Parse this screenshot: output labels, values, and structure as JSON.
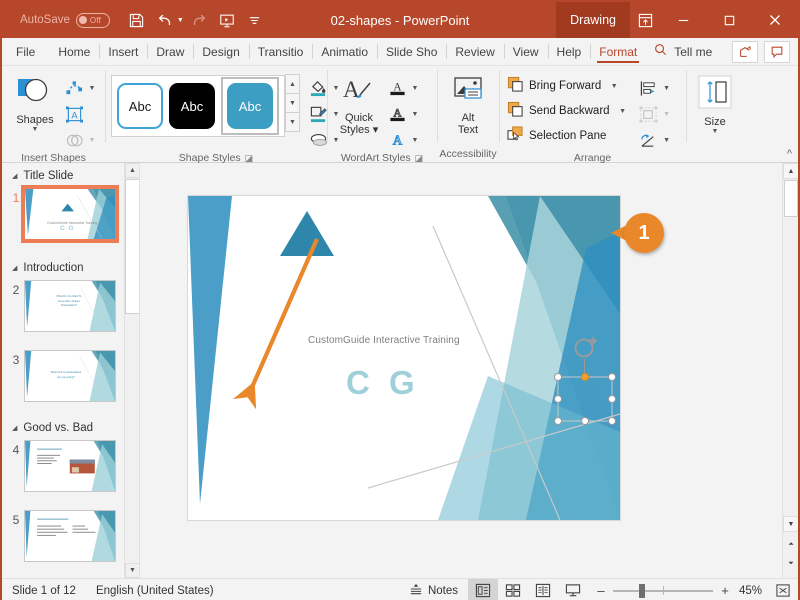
{
  "titlebar": {
    "autosave_label": "AutoSave",
    "autosave_state": "Off",
    "document_title": "02-shapes  -  PowerPoint",
    "ribbon_display_label": "Drawing",
    "qat": [
      {
        "name": "save-icon",
        "tip": "Save"
      },
      {
        "name": "undo-icon",
        "tip": "Undo"
      },
      {
        "name": "redo-icon",
        "tip": "Redo"
      },
      {
        "name": "start-presentation-icon",
        "tip": "Start From Beginning"
      },
      {
        "name": "customize-qat-icon",
        "tip": "Customize Quick Access Toolbar"
      }
    ],
    "window_controls": [
      "minimize",
      "restore",
      "close"
    ],
    "accent_color": "#b7472a"
  },
  "tabs": [
    {
      "label": "File",
      "active": false
    },
    {
      "label": "Home",
      "active": false
    },
    {
      "label": "Insert",
      "active": false
    },
    {
      "label": "Draw",
      "active": false
    },
    {
      "label": "Design",
      "active": false
    },
    {
      "label": "Transitio",
      "active": false
    },
    {
      "label": "Animatio",
      "active": false
    },
    {
      "label": "Slide Sho",
      "active": false
    },
    {
      "label": "Review",
      "active": false
    },
    {
      "label": "View",
      "active": false
    },
    {
      "label": "Help",
      "active": false
    },
    {
      "label": "Format",
      "active": true
    }
  ],
  "tellme": {
    "label": "Tell me",
    "icon": "search-icon"
  },
  "tab_right_buttons": [
    {
      "name": "share-button",
      "icon": "share-icon"
    },
    {
      "name": "comments-button",
      "icon": "comment-icon"
    }
  ],
  "ribbon": {
    "collapse_label": "^",
    "groups": [
      {
        "name": "insert-shapes",
        "label": "Insert Shapes",
        "big_button": {
          "label": "Shapes",
          "icon": "shapes-icon",
          "has_dropdown": true
        },
        "mini_items": [
          {
            "name": "edit-shape-icon",
            "has_dropdown": true,
            "disabled": false
          },
          {
            "name": "draw-textbox-icon",
            "has_dropdown": false,
            "disabled": false
          },
          {
            "name": "merge-shapes-icon",
            "has_dropdown": true,
            "disabled": true
          }
        ]
      },
      {
        "name": "shape-styles",
        "label": "Shape Styles",
        "has_dialog_launcher": true,
        "gallery": [
          {
            "text": "Abc",
            "style": "outline-blue",
            "selected": false
          },
          {
            "text": "Abc",
            "style": "fill-black",
            "selected": false
          },
          {
            "text": "Abc",
            "style": "fill-teal",
            "selected": true
          }
        ],
        "mini_items": [
          {
            "name": "shape-fill-icon",
            "has_dropdown": true
          },
          {
            "name": "shape-outline-icon",
            "has_dropdown": true
          },
          {
            "name": "shape-effects-icon",
            "has_dropdown": true
          }
        ]
      },
      {
        "name": "wordart-styles",
        "label": "WordArt Styles",
        "has_dialog_launcher": true,
        "big_button": {
          "label": "Quick\nStyles",
          "icon": "wordart-quick-styles-icon",
          "has_dropdown": true
        },
        "mini_items": [
          {
            "name": "text-fill-icon",
            "has_dropdown": true
          },
          {
            "name": "text-outline-icon",
            "has_dropdown": true
          },
          {
            "name": "text-effects-icon",
            "has_dropdown": true
          }
        ]
      },
      {
        "name": "accessibility",
        "label": "Accessibility",
        "big_button": {
          "label": "Alt\nText",
          "icon": "alt-text-icon",
          "has_dropdown": false
        }
      },
      {
        "name": "arrange",
        "label": "Arrange",
        "menu_items": [
          {
            "label": "Bring Forward",
            "icon": "bring-forward-icon",
            "has_dropdown": true,
            "disabled": false
          },
          {
            "label": "Send Backward",
            "icon": "send-backward-icon",
            "has_dropdown": true,
            "disabled": false
          },
          {
            "label": "Selection Pane",
            "icon": "selection-pane-icon",
            "has_dropdown": false,
            "disabled": false
          }
        ],
        "mini_items": [
          {
            "name": "align-objects-icon",
            "has_dropdown": true,
            "disabled": false
          },
          {
            "name": "group-objects-icon",
            "has_dropdown": true,
            "disabled": true
          },
          {
            "name": "rotate-objects-icon",
            "has_dropdown": true,
            "disabled": false
          }
        ]
      },
      {
        "name": "size",
        "label": "Size",
        "big_button": {
          "label": "Size",
          "icon": "size-icon",
          "has_dropdown": true
        }
      }
    ]
  },
  "thumbnail_pane": {
    "sections": [
      {
        "title": "Title Slide",
        "slides": [
          {
            "number": "1",
            "selected": true,
            "lines": [],
            "subtitle": "CustomGuide Interactive Training",
            "cg": "C G"
          }
        ]
      },
      {
        "title": "Introduction",
        "slides": [
          {
            "number": "2",
            "selected": false,
            "lines": [
              "What Do You Want To",
              "Know After Today's",
              "Presentation?"
            ]
          },
          {
            "number": "3",
            "selected": false,
            "lines": [
              "What kind of presentations",
              "are you giving?"
            ]
          }
        ]
      },
      {
        "title": "Good vs. Bad",
        "slides": [
          {
            "number": "4",
            "selected": false,
            "lines": [
              "What Makes a Bad Presentation?"
            ]
          },
          {
            "number": "5",
            "selected": false,
            "lines": [
              "What Makes a Presentation Good?"
            ]
          }
        ]
      }
    ]
  },
  "slide": {
    "subtitle": "CustomGuide Interactive Training",
    "logo_text": "C G",
    "selected_shape": {
      "name": "triangle",
      "fill": "#2e86ab"
    },
    "callout_badge": "1",
    "annotation_arrow_color": "#e8882b"
  },
  "statusbar": {
    "slide_indicator": "Slide 1 of 12",
    "language": "English (United States)",
    "notes_label": "Notes",
    "views": [
      {
        "name": "normal-view",
        "active": true
      },
      {
        "name": "slide-sorter-view",
        "active": false
      },
      {
        "name": "reading-view",
        "active": false
      },
      {
        "name": "slideshow-view",
        "active": false
      }
    ],
    "zoom_out": "–",
    "zoom_in": "+",
    "zoom_level": "45%",
    "fit_button": "fit-to-window-icon"
  }
}
